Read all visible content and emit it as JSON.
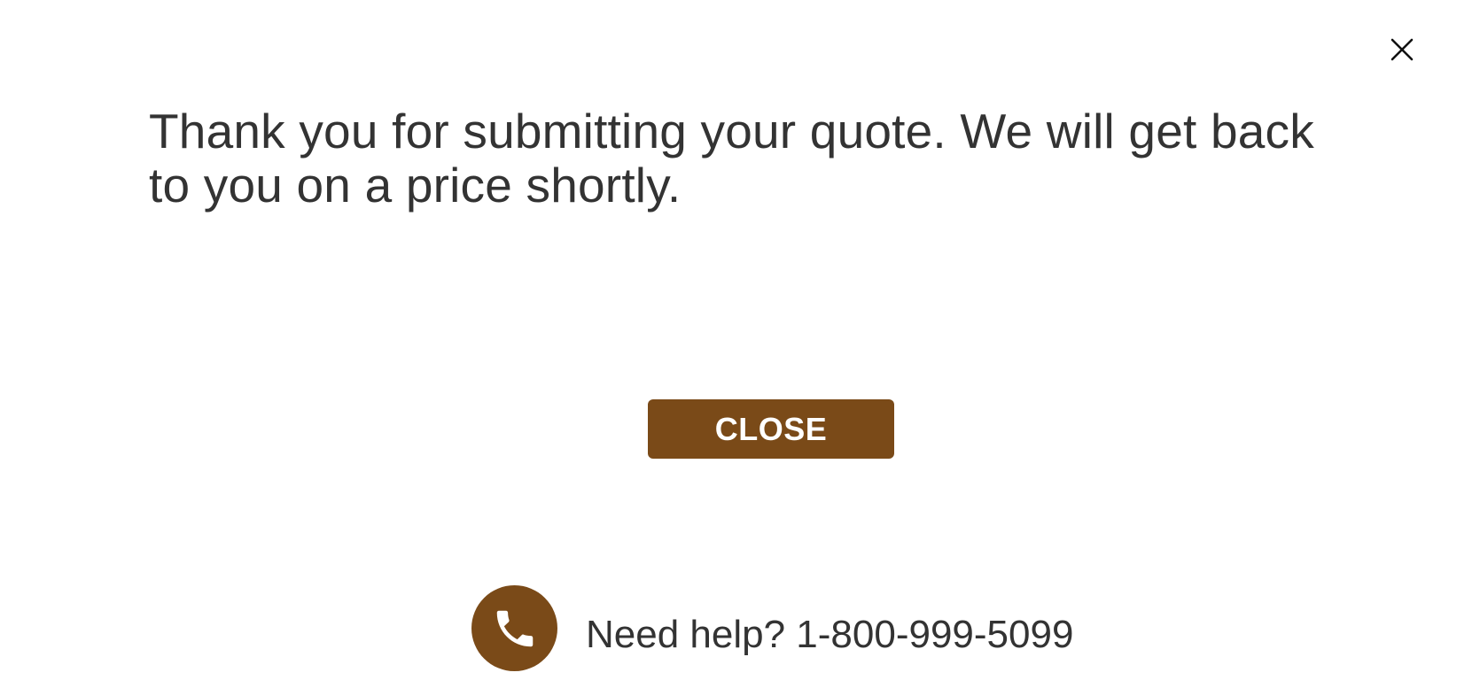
{
  "modal": {
    "close_icon": "close-icon",
    "message": "Thank you for submitting your quote. We will get back to you on a price shortly.",
    "close_button_label": "CLOSE",
    "help": {
      "icon": "phone-icon",
      "text": "Need help? 1-800-999-5099"
    },
    "colors": {
      "accent": "#7a4a18",
      "text": "#333333",
      "background": "#ffffff"
    }
  }
}
